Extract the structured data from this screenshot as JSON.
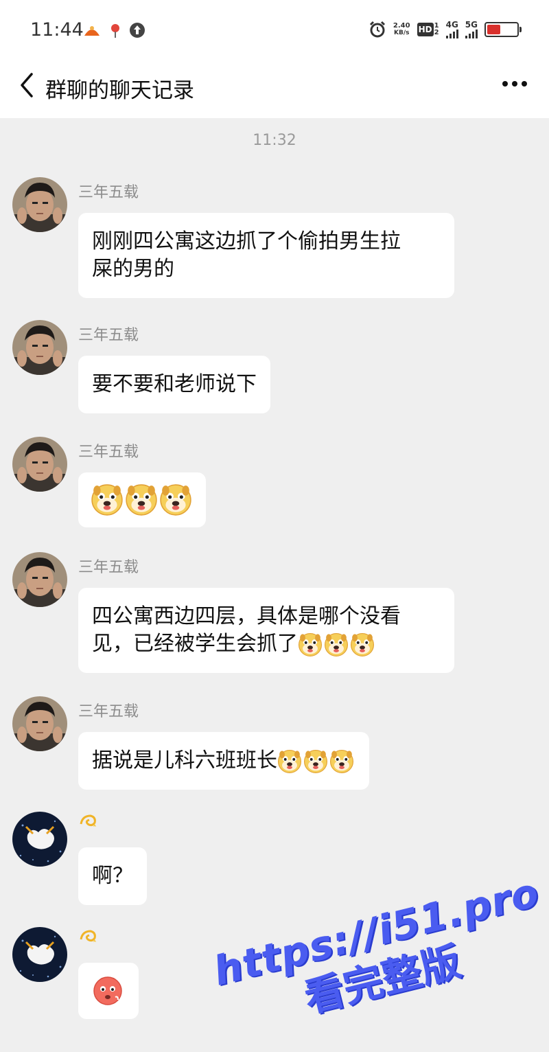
{
  "status_bar": {
    "time": "11:44",
    "net_speed_value": "2.40",
    "net_speed_unit": "KB/s",
    "hd_label": "HD",
    "hd_sub_1": "1",
    "hd_sub_2": "2",
    "net1": "4G",
    "net2": "5G",
    "battery_level": 0.45,
    "battery_color": "#d9302c",
    "icons": [
      "app-notification-icon",
      "location-icon",
      "upload-icon",
      "alarm-icon",
      "hd-icon",
      "signal-4g-icon",
      "signal-5g-icon",
      "battery-icon"
    ]
  },
  "nav": {
    "title": "群聊的聊天记录",
    "back_icon": "chevron-left-icon",
    "more_icon": "more-dots-icon"
  },
  "timestamp": "11:32",
  "messages": [
    {
      "sender": "三年五载",
      "text": "刚刚四公寓这边抓了个偷拍男生拉屎的男的",
      "line1": "刚刚四公寓这边抓了个偷拍男生拉",
      "line2": "屎的男的"
    },
    {
      "sender": "三年五载",
      "text": "要不要和老师说下"
    },
    {
      "sender": "三年五载",
      "text": "",
      "emoji": "puppy-face-emoji",
      "emoji_count": 3
    },
    {
      "sender": "三年五载",
      "line1": "四公寓西边四层，具体是哪个没看",
      "line2": "见，已经被学生会抓了",
      "emoji": "puppy-face-emoji",
      "emoji_count": 3
    },
    {
      "sender": "三年五载",
      "text": "据说是儿科六班班长",
      "emoji": "puppy-face-emoji",
      "emoji_count": 3
    },
    {
      "sender": "",
      "sender_emoji": "dizzy-emoji",
      "text": "啊？"
    },
    {
      "sender": "",
      "sender_emoji": "dizzy-emoji",
      "text": "",
      "emoji": "flushed-face-emoji",
      "emoji_count": 1
    }
  ],
  "watermark": {
    "url": "https://i51.pro",
    "sub": "看完整版",
    "color": "#4a5cf0"
  }
}
